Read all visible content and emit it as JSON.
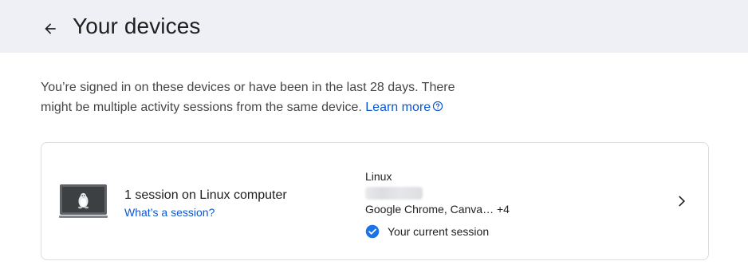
{
  "header": {
    "title": "Your devices",
    "back_icon": "arrow-back-icon"
  },
  "intro": {
    "text": "You’re signed in on these devices or have been in the last 28 days. There might be multiple activity sessions from the same device.",
    "learn_more_label": "Learn more",
    "help_icon": "help-circle-icon"
  },
  "device_card": {
    "icon": "linux-laptop-icon",
    "title": "1 session on Linux computer",
    "whats_session_label": "What’s a session?",
    "os": "Linux",
    "browsers": "Google Chrome, Canva… +4",
    "current_session_label": "Your current session",
    "current_session_icon": "check-circle-icon",
    "chevron_icon": "chevron-right-icon"
  },
  "colors": {
    "header_bg": "#eef0f5",
    "link": "#0b57d0",
    "check": "#1a73e8",
    "card_border": "#dadce0"
  }
}
